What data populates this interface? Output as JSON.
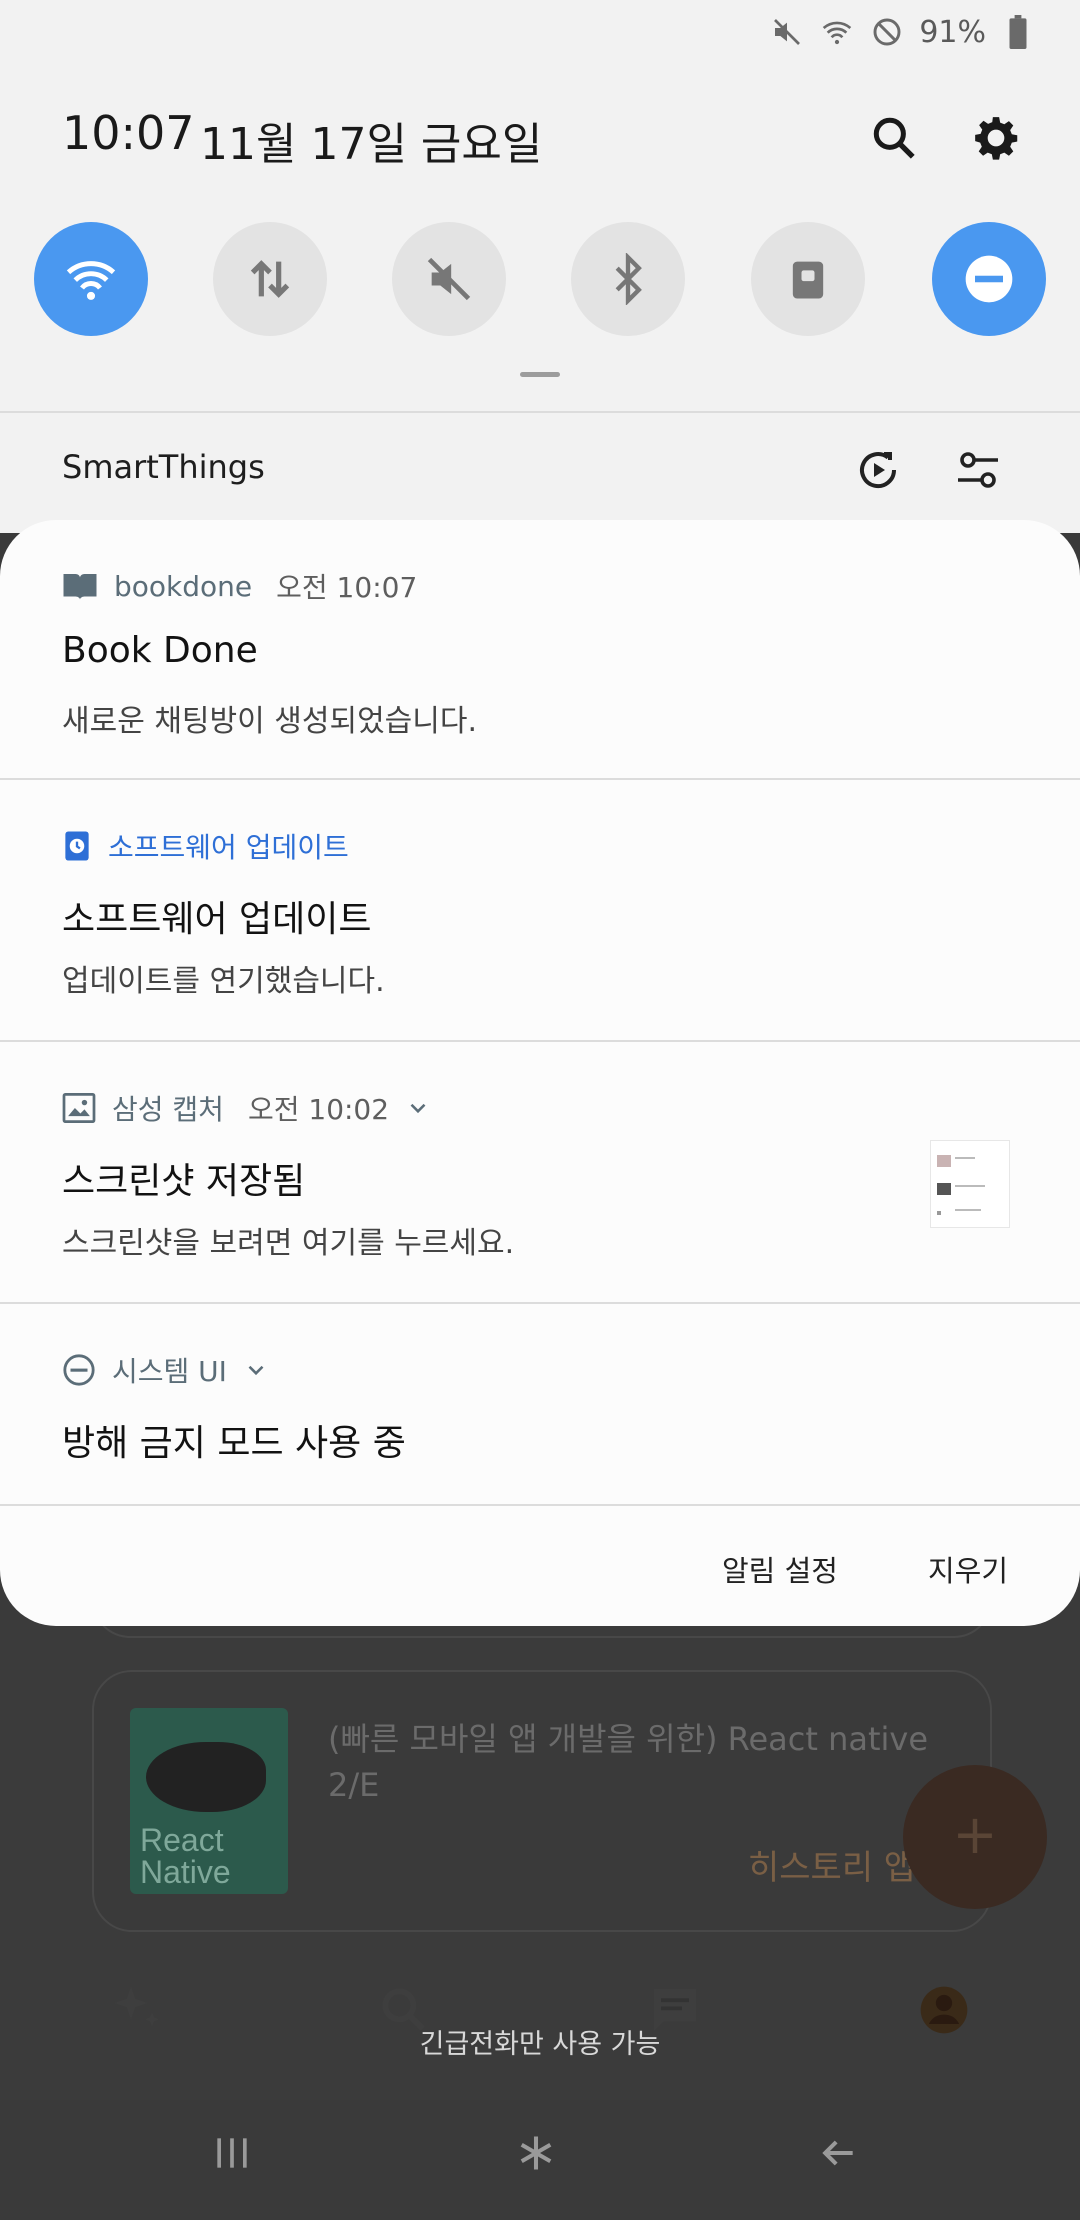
{
  "status_bar": {
    "battery": "91%"
  },
  "header": {
    "time": "10:07",
    "date": "11월 17일 금요일"
  },
  "smartthings": {
    "label": "SmartThings"
  },
  "notifications": [
    {
      "app": "bookdone",
      "time": "오전 10:07",
      "title": "Book Done",
      "body": "새로운 채팅방이 생성되었습니다."
    },
    {
      "app": "소프트웨어 업데이트",
      "time": "",
      "title": "소프트웨어 업데이트",
      "body": "업데이트를 연기했습니다."
    },
    {
      "app": "삼성 캡처",
      "time": "오전 10:02",
      "title": "스크린샷 저장됨",
      "body": "스크린샷을 보려면 여기를 누르세요."
    },
    {
      "app": "시스템 UI",
      "time": "",
      "title": "방해 금지 모드 사용 중",
      "body": ""
    }
  ],
  "footer": {
    "settings_label": "알림 설정",
    "clear_label": "지우기"
  },
  "background_app": {
    "book_title": "(빠른 모바일 앱 개발을 위한) React native 2/E",
    "cover_text": "React Native",
    "history_label": "히스토리 앱",
    "fab_label": "+"
  },
  "toast": "긴급전화만 사용 가능",
  "colors": {
    "accent": "#4a98f0",
    "panel_bg": "#f2f2f2",
    "card_bg": "#fcfcfc"
  }
}
